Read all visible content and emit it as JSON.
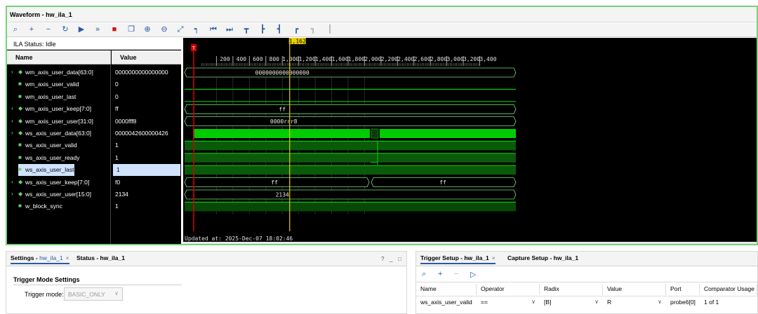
{
  "waveform": {
    "title": "Waveform - hw_ila_1",
    "ila_status": "ILA Status: Idle",
    "col_name": "Name",
    "col_value": "Value",
    "signals": [
      {
        "name": "wm_axis_user_data[63:0]",
        "value": "0000000000000000",
        "bus": true,
        "selected": false
      },
      {
        "name": "wm_axis_user_valid",
        "value": "0",
        "bus": false,
        "selected": false
      },
      {
        "name": "wm_axis_user_last",
        "value": "0",
        "bus": false,
        "selected": false
      },
      {
        "name": "wm_axis_user_keep[7:0]",
        "value": "ff",
        "bus": true,
        "selected": false
      },
      {
        "name": "wm_axis_user_user[31:0]",
        "value": "0000fff8",
        "bus": true,
        "selected": false
      },
      {
        "name": "ws_axis_user_data[63:0]",
        "value": "0000042600000426",
        "bus": true,
        "selected": false
      },
      {
        "name": "ws_axis_user_valid",
        "value": "1",
        "bus": false,
        "selected": false
      },
      {
        "name": "ws_axis_user_ready",
        "value": "1",
        "bus": false,
        "selected": false
      },
      {
        "name": "ws_axis_user_last",
        "value": "1",
        "bus": false,
        "selected": true
      },
      {
        "name": "ws_axis_user_keep[7:0]",
        "value": "f0",
        "bus": true,
        "selected": false
      },
      {
        "name": "ws_axis_user_user[15:0]",
        "value": "2134",
        "bus": true,
        "selected": false
      },
      {
        "name": "w_block_sync",
        "value": "1",
        "bus": false,
        "selected": false
      }
    ],
    "bus_labels": {
      "wm_data": "0000000000000000",
      "wm_keep": "ff",
      "wm_user": "0000rrr8",
      "ws_keep_1": "ff",
      "ws_keep_2": "ff",
      "ws_user": "2134"
    },
    "trigger_marker": "T",
    "cursor_label": "1,162",
    "axis_ticks": [
      "200",
      "400",
      "600",
      "800",
      "1,000",
      "1,200",
      "1,400",
      "1,600",
      "1,800",
      "2,000",
      "2,200",
      "2,400",
      "2,600",
      "2,800",
      "3,000",
      "3,200",
      "3,400"
    ],
    "updated_at": "Updated at: 2025-Dec-07 18:02:46",
    "colors": {
      "wave": "#00cc00",
      "bus_line": "#7adc7a",
      "cursor": "#e8d000",
      "trigger": "#d00000",
      "background": "#000000"
    },
    "toolbar_icons": [
      "search-icon",
      "plus-icon",
      "minus-icon",
      "refresh-icon",
      "play-icon",
      "fast-forward-icon",
      "stop-icon",
      "export-icon",
      "zoom-in-icon",
      "zoom-out-icon",
      "zoom-fit-icon",
      "marker-icon",
      "go-first-icon",
      "go-last-icon",
      "add-marker-icon",
      "marker-prev-icon",
      "marker-next-icon",
      "marker-place-icon",
      "marker-disabled-icon",
      "marker-remove-icon"
    ]
  },
  "settings_panel": {
    "tab_settings_prefix": "Settings - ",
    "tab_settings_link": "hw_ila_1",
    "tab_close": "×",
    "tab_status": "Status - hw_ila_1",
    "help": "?",
    "minimize": "_",
    "maximize": "□",
    "section_title": "Trigger Mode Settings",
    "trigger_mode_label": "Trigger mode:",
    "trigger_mode_value": "BASIC_ONLY"
  },
  "trigger_panel": {
    "tab_trigger_setup": "Trigger Setup - hw_ila_1",
    "tab_close": "×",
    "tab_capture_setup": "Capture Setup - hw_ila_1",
    "columns": [
      "Name",
      "Operator",
      "Radix",
      "Value",
      "Port",
      "Comparator Usage"
    ],
    "rows": [
      {
        "name": "ws_axis_user_valid",
        "operator": "==",
        "radix": "[B]",
        "value": "R",
        "port": "probe6[0]",
        "usage": "1 of 1"
      }
    ]
  }
}
